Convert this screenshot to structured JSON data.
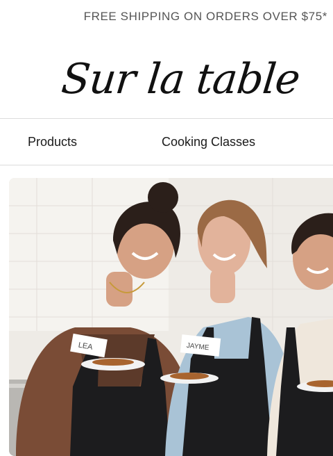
{
  "promo": {
    "text": "FREE SHIPPING ON ORDERS OVER $75*"
  },
  "brand": {
    "logo_text": "Sur la table"
  },
  "nav": {
    "items": [
      {
        "label": "Products"
      },
      {
        "label": "Cooking Classes"
      }
    ]
  },
  "hero": {
    "name_tags": [
      "LEA",
      "JAYME"
    ],
    "colors": {
      "wall": "#eeebe6",
      "apron": "#1c1c1e",
      "skin": "#d6a184",
      "hair_dark": "#2b1f1a",
      "hair_auburn": "#9b6a45",
      "shirt_blue": "#a9c3d6",
      "shirt_brown": "#7a4c36"
    }
  }
}
